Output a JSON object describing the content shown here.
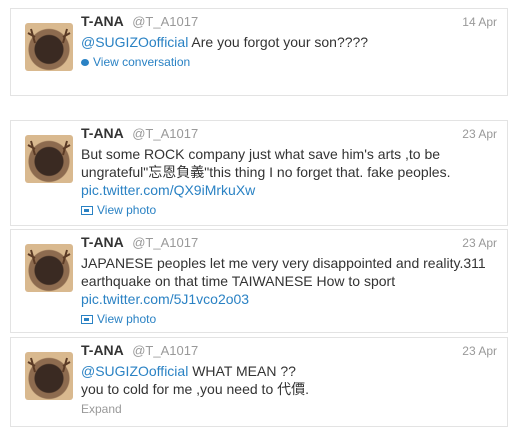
{
  "tweets": [
    {
      "name": "T-ANA",
      "handle": "@T_A1017",
      "time": "14 Apr",
      "mention": "@SUGIZOofficial",
      "text": " Are you forgot your son????",
      "link": "",
      "action": "View conversation"
    },
    {
      "name": "T-ANA",
      "handle": "@T_A1017",
      "time": "23 Apr",
      "mention": "",
      "text": "But  some ROCK company just what save him's arts ,to be ungrateful\"忘恩負義\"this thing I no forget that. fake peoples.",
      "link": "pic.twitter.com/QX9iMrkuXw",
      "action": "View photo"
    },
    {
      "name": "T-ANA",
      "handle": "@T_A1017",
      "time": "23 Apr",
      "mention": "",
      "text": "JAPANESE peoples let me very very  disappointed and reality.311 earthquake on that time TAIWANESE How to sport",
      "link": "pic.twitter.com/5J1vco2o03",
      "action": "View photo"
    },
    {
      "name": "T-ANA",
      "handle": "@T_A1017",
      "time": "23 Apr",
      "mention": "@SUGIZOofficial",
      "text": " WHAT MEAN ??",
      "text2": "you to cold for me ,you need to 代價.",
      "link": "",
      "action": "Expand"
    }
  ]
}
